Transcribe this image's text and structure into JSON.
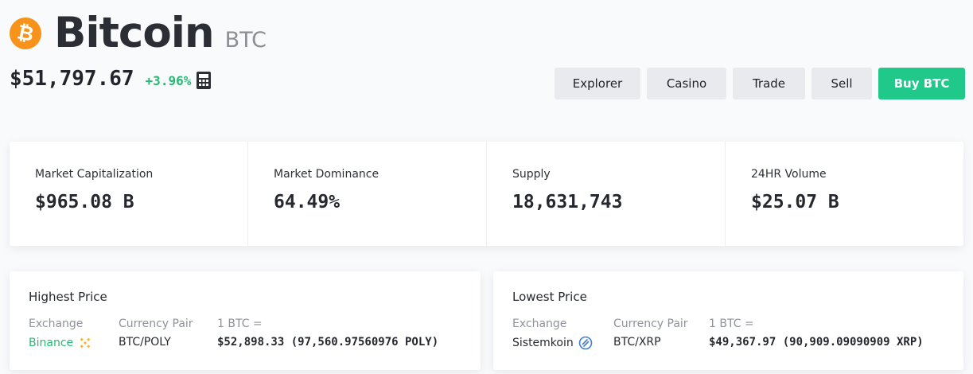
{
  "coin": {
    "logo_glyph": "₿",
    "name": "Bitcoin",
    "symbol": "BTC",
    "price": "$51,797.67",
    "change": "+3.96%",
    "change_color": "#27b874",
    "brand_color": "#f7931a"
  },
  "actions": {
    "explorer": "Explorer",
    "casino": "Casino",
    "trade": "Trade",
    "sell": "Sell",
    "buy": "Buy BTC",
    "buy_color": "#20c98a"
  },
  "stats": [
    {
      "label": "Market Capitalization",
      "value": "$965.08 B"
    },
    {
      "label": "Market Dominance",
      "value": "64.49%"
    },
    {
      "label": "Supply",
      "value": "18,631,743"
    },
    {
      "label": "24HR Volume",
      "value": "$25.07 B"
    }
  ],
  "highest": {
    "title": "Highest Price",
    "exchange_label": "Exchange",
    "exchange": "Binance",
    "exchange_icon": "binance-icon",
    "pair_label": "Currency Pair",
    "pair": "BTC/POLY",
    "rate_label": "1 BTC =",
    "rate": "$52,898.33 (97,560.97560976 POLY)"
  },
  "lowest": {
    "title": "Lowest Price",
    "exchange_label": "Exchange",
    "exchange": "Sistemkoin",
    "exchange_icon": "sistemkoin-icon",
    "pair_label": "Currency Pair",
    "pair": "BTC/XRP",
    "rate_label": "1 BTC =",
    "rate": "$49,367.97 (90,909.09090909 XRP)"
  }
}
